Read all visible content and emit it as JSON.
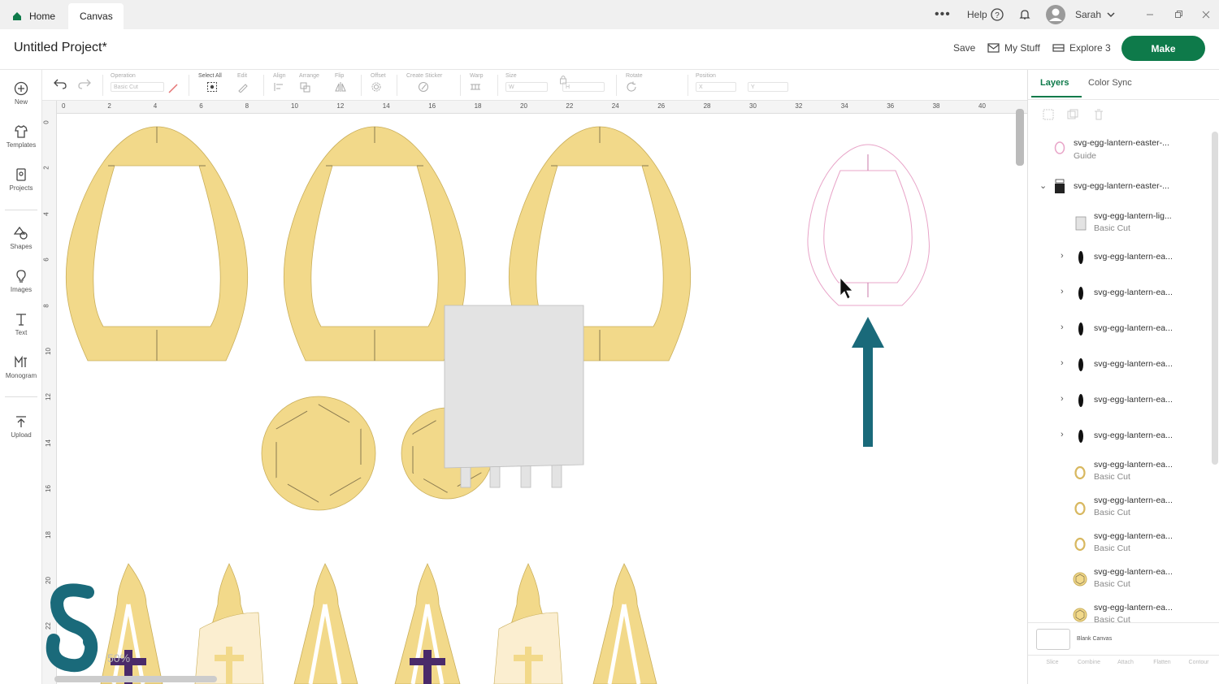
{
  "titlebar": {
    "tabs": [
      {
        "label": "Home"
      },
      {
        "label": "Canvas"
      }
    ],
    "help_label": "Help",
    "user_name": "Sarah"
  },
  "header": {
    "project_title": "Untitled Project*",
    "save_label": "Save",
    "mystuff_label": "My Stuff",
    "machine_label": "Explore 3",
    "make_label": "Make",
    "brand_color": "#0e7a4a"
  },
  "leftbar": {
    "items": [
      {
        "label": "New",
        "icon": "plus-circle-icon"
      },
      {
        "label": "Templates",
        "icon": "shirt-icon"
      },
      {
        "label": "Projects",
        "icon": "projects-icon"
      },
      {
        "label": "Shapes",
        "icon": "shapes-icon"
      },
      {
        "label": "Images",
        "icon": "lightbulb-icon"
      },
      {
        "label": "Text",
        "icon": "text-icon"
      },
      {
        "label": "Monogram",
        "icon": "monogram-icon"
      },
      {
        "label": "Upload",
        "icon": "upload-icon"
      }
    ]
  },
  "toolbar": {
    "operation_label": "Operation",
    "operation_value": "Basic Cut",
    "select_all_label": "Select All",
    "edit_label": "Edit",
    "align_label": "Align",
    "arrange_label": "Arrange",
    "flip_label": "Flip",
    "offset_label": "Offset",
    "create_sticker_label": "Create Sticker",
    "warp_label": "Warp",
    "size_label": "Size",
    "rotate_label": "Rotate",
    "position_label": "Position",
    "w_label": "W",
    "h_label": "H",
    "x_label": "X",
    "y_label": "Y"
  },
  "rulers": {
    "top": [
      "0",
      "2",
      "4",
      "6",
      "8",
      "10",
      "12",
      "14",
      "16",
      "18",
      "20",
      "22",
      "24",
      "26",
      "28",
      "30",
      "32",
      "34",
      "36",
      "38",
      "40"
    ],
    "left": [
      "0",
      "2",
      "4",
      "6",
      "8",
      "10",
      "12",
      "14",
      "16",
      "18",
      "20",
      "22"
    ]
  },
  "canvas": {
    "zoom": "50%",
    "egg_fill": "#f2d98a",
    "arrow_color": "#1a6a7a"
  },
  "panel": {
    "tabs": [
      {
        "label": "Layers"
      },
      {
        "label": "Color Sync"
      }
    ],
    "layers": [
      {
        "name": "svg-egg-lantern-easter-...",
        "op": "Guide"
      },
      {
        "name": "svg-egg-lantern-easter-...",
        "op": ""
      },
      {
        "name": "svg-egg-lantern-lig...",
        "op": "Basic Cut"
      },
      {
        "name": "svg-egg-lantern-ea...",
        "op": ""
      },
      {
        "name": "svg-egg-lantern-ea...",
        "op": ""
      },
      {
        "name": "svg-egg-lantern-ea...",
        "op": ""
      },
      {
        "name": "svg-egg-lantern-ea...",
        "op": ""
      },
      {
        "name": "svg-egg-lantern-ea...",
        "op": ""
      },
      {
        "name": "svg-egg-lantern-ea...",
        "op": ""
      },
      {
        "name": "svg-egg-lantern-ea...",
        "op": "Basic Cut"
      },
      {
        "name": "svg-egg-lantern-ea...",
        "op": "Basic Cut"
      },
      {
        "name": "svg-egg-lantern-ea...",
        "op": "Basic Cut"
      },
      {
        "name": "svg-egg-lantern-ea...",
        "op": "Basic Cut"
      },
      {
        "name": "svg-egg-lantern-ea...",
        "op": "Basic Cut"
      }
    ],
    "blank_canvas_label": "Blank Canvas",
    "bottom_tools": [
      {
        "label": "Slice"
      },
      {
        "label": "Combine"
      },
      {
        "label": "Attach"
      },
      {
        "label": "Flatten"
      },
      {
        "label": "Contour"
      }
    ]
  }
}
